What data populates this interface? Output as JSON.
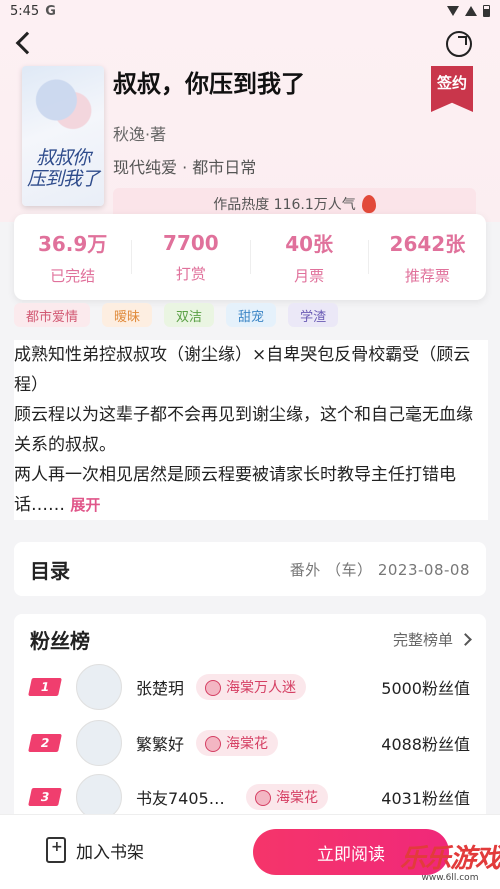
{
  "status_bar": {
    "time": "5:45",
    "g_icon": "G"
  },
  "book": {
    "title": "叔叔，你压到我了",
    "cover_title": "叔叔你\n压到我了",
    "author": "秋逸·著",
    "genre": "现代纯爱 · 都市日常",
    "sign_badge": "签约",
    "heat": "作品热度 116.1万人气"
  },
  "stats": [
    {
      "value": "36.9万",
      "label": "已完结"
    },
    {
      "value": "7700",
      "label": "打赏"
    },
    {
      "value": "40张",
      "label": "月票"
    },
    {
      "value": "2642张",
      "label": "推荐票"
    }
  ],
  "tags": [
    {
      "label": "都市爱情",
      "bg": "#fbeaed",
      "fg": "#d25a74"
    },
    {
      "label": "暧昧",
      "bg": "#fdeee1",
      "fg": "#e08a3a"
    },
    {
      "label": "双洁",
      "bg": "#eaf5e2",
      "fg": "#5aa045"
    },
    {
      "label": "甜宠",
      "bg": "#e5f1fb",
      "fg": "#3d86c6"
    },
    {
      "label": "学渣",
      "bg": "#ebe8f7",
      "fg": "#6a5bb5"
    }
  ],
  "intro": {
    "line1": "成熟知性弟控叔叔攻（谢尘缘）×自卑哭包反骨校霸受（顾云程）",
    "line2": "顾云程以为这辈子都不会再见到谢尘缘，这个和自己毫无血缘关系的叔叔。",
    "line3": "两人再一次相见居然是顾云程要被请家长时教导主任打错电话……",
    "expand": "展开"
  },
  "toc": {
    "title": "目录",
    "latest": "番外 （车） 2023-08-08"
  },
  "fans": {
    "title": "粉丝榜",
    "more": "完整榜单",
    "rows": [
      {
        "rank": "1",
        "name": "张楚玥",
        "badge": "海棠万人迷",
        "score": "5000粉丝值"
      },
      {
        "rank": "2",
        "name": "繁繁好",
        "badge": "海棠花",
        "score": "4088粉丝值"
      },
      {
        "rank": "3",
        "name": "书友7405…",
        "badge": "海棠花",
        "score": "4031粉丝值"
      }
    ]
  },
  "bottom": {
    "shelf": "加入书架",
    "read": "立即阅读"
  },
  "watermark": {
    "main": "乐乐游戏",
    "sub": "www.6ll.com"
  }
}
